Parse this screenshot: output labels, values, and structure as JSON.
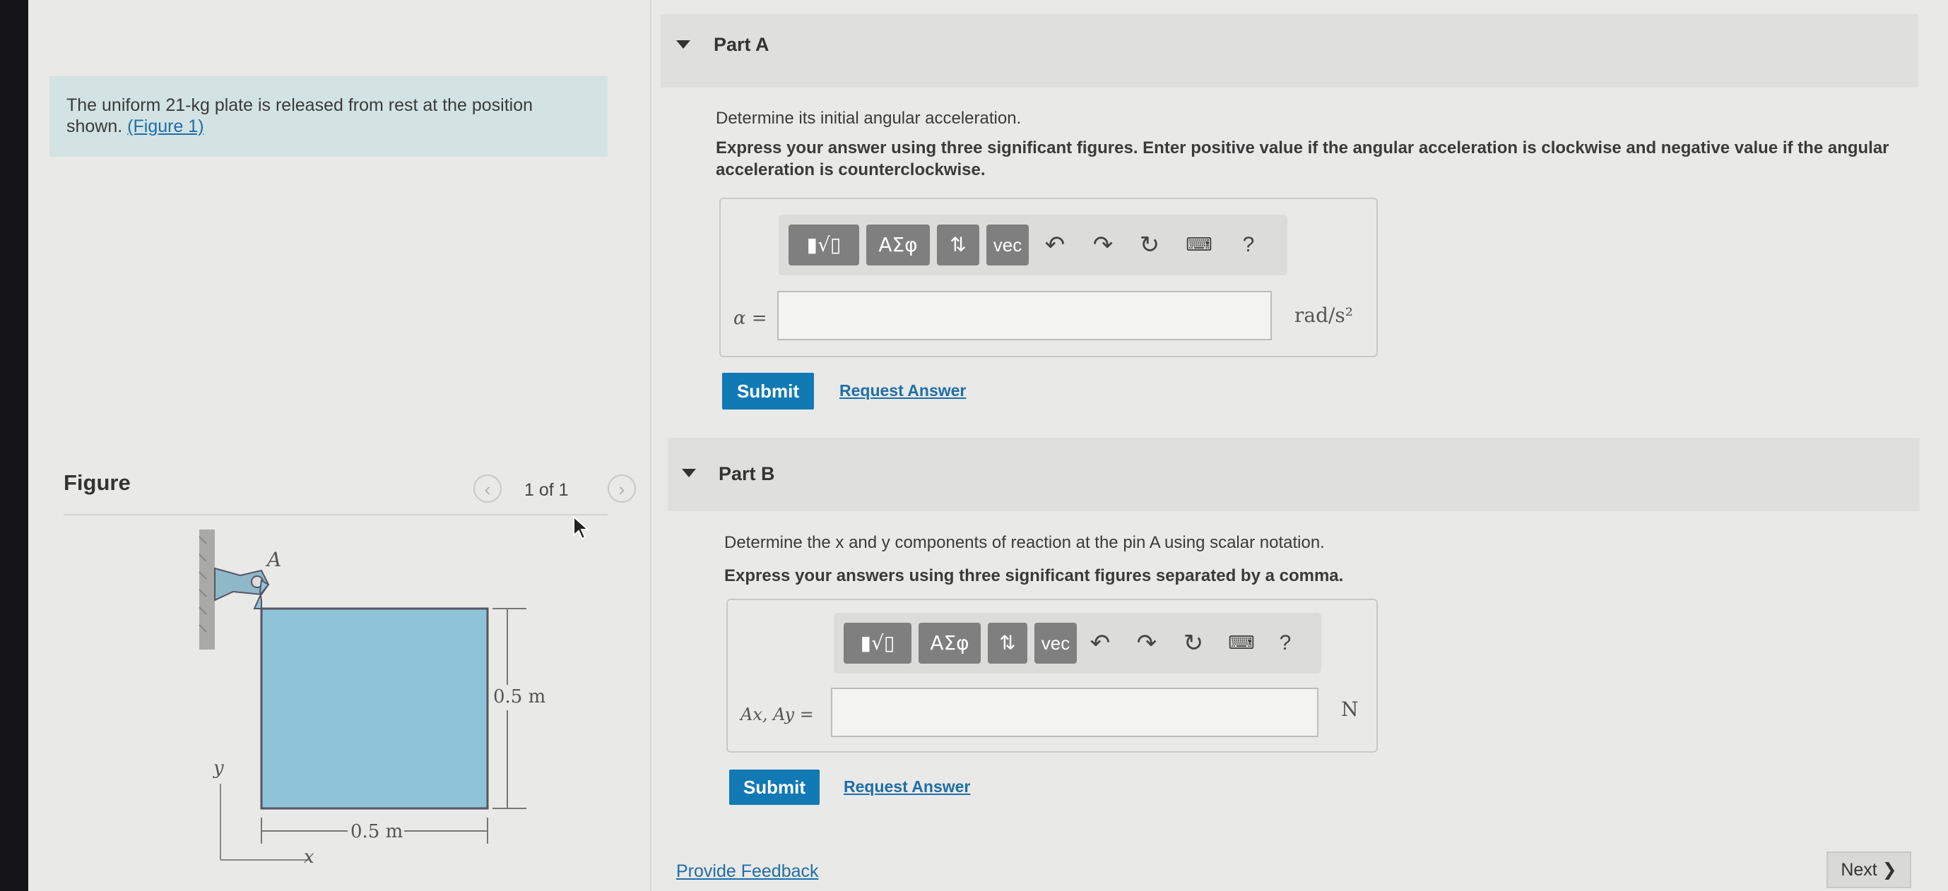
{
  "problem": {
    "text": "The uniform 21-kg plate is released from rest at the position shown.",
    "figure_link": "(Figure 1)"
  },
  "figure": {
    "title": "Figure",
    "pager_text": "1 of 1",
    "label_A": "A",
    "label_height": "0.5 m",
    "label_width": "0.5 m",
    "label_x": "x",
    "label_y": "y",
    "plate_color": "#8fc4d8"
  },
  "partA": {
    "title": "Part A",
    "question": "Determine its initial angular acceleration.",
    "instructions": "Express your answer using three significant figures. Enter positive value if the angular acceleration is clockwise and negative value if the angular acceleration is counterclockwise.",
    "toolbar": {
      "templates": "▮√▯",
      "greek": "ΑΣφ",
      "arrows": "⇅",
      "vec": "vec",
      "help": "?"
    },
    "var_label": "α =",
    "value": "",
    "unit": "rad/s²",
    "submit": "Submit",
    "request": "Request Answer"
  },
  "partB": {
    "title": "Part B",
    "question": "Determine the x and y components of reaction at the pin A using scalar notation.",
    "instructions": "Express your answers using three significant figures separated by a comma.",
    "toolbar": {
      "templates": "▮√▯",
      "greek": "ΑΣφ",
      "arrows": "⇅",
      "vec": "vec",
      "help": "?"
    },
    "var_label": "Ax, Ay =",
    "value": "",
    "unit": "N",
    "submit": "Submit",
    "request": "Request Answer"
  },
  "footer": {
    "feedback": "Provide Feedback",
    "next": "Next ❯"
  },
  "colors": {
    "accent": "#1179b4",
    "link": "#1f6ea8",
    "problem_bg": "#d3e3e3"
  }
}
